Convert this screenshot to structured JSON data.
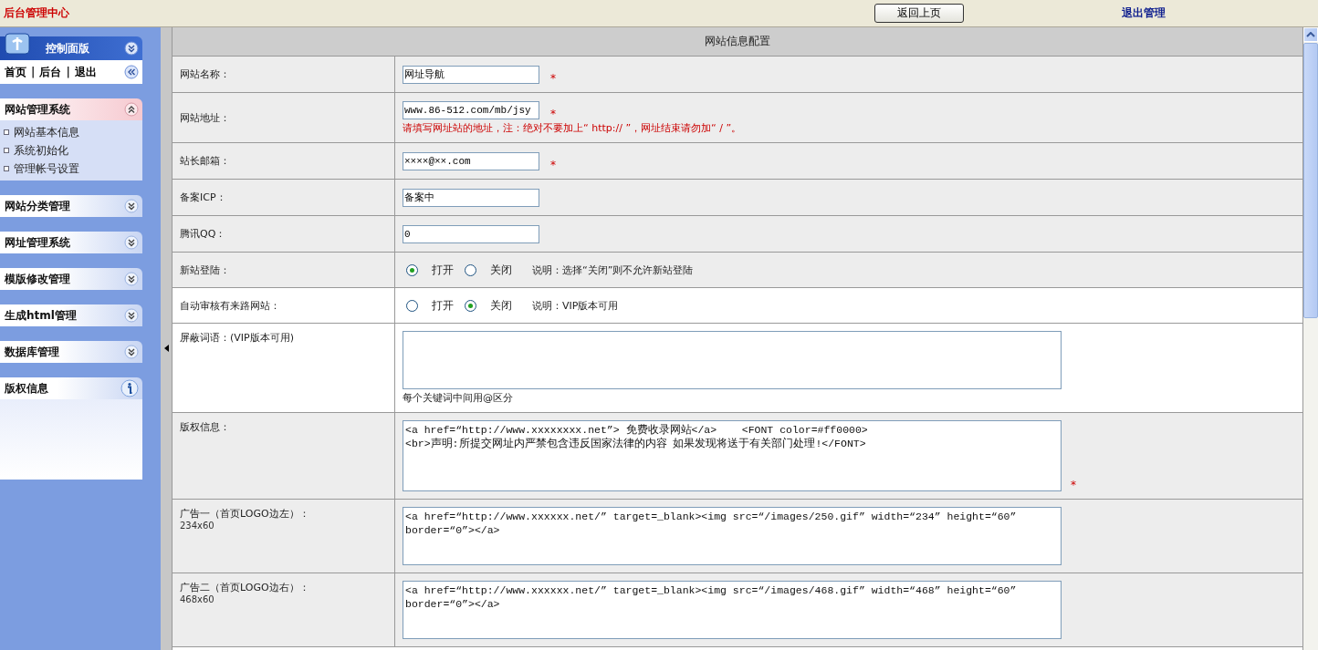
{
  "header": {
    "title": "后台管理中心",
    "back_button": "返回上页",
    "logout_link": "退出管理"
  },
  "sidebar": {
    "panel_title": "控制面版",
    "quick_links": [
      {
        "kind": "link",
        "label": "首页"
      },
      {
        "kind": "sep",
        "label": "|"
      },
      {
        "kind": "link",
        "label": "后台"
      },
      {
        "kind": "sep",
        "label": "|"
      },
      {
        "kind": "link",
        "label": "退出"
      }
    ],
    "groups": [
      {
        "kind": "menu",
        "title": "网站管理系统",
        "expanded": true,
        "items": [
          "网站基本信息",
          "系统初始化",
          "管理帐号设置"
        ]
      },
      {
        "kind": "menu",
        "title": "网站分类管理",
        "expanded": false
      },
      {
        "kind": "menu",
        "title": "网址管理系统",
        "expanded": false
      },
      {
        "kind": "menu",
        "title": "模版修改管理",
        "expanded": false
      },
      {
        "kind": "menu",
        "title": "生成html管理",
        "expanded": false
      },
      {
        "kind": "menu",
        "title": "数据库管理",
        "expanded": false
      },
      {
        "kind": "info",
        "title": "版权信息",
        "expanded": true
      }
    ]
  },
  "form": {
    "title": "网站信息配置",
    "fields": [
      {
        "kind": "text",
        "label": "网站名称：",
        "value": "网址导航",
        "required_mark": "*",
        "highlighted": false
      },
      {
        "kind": "text",
        "label": "网站地址：",
        "value": "www.86-512.com/mb/jsy",
        "required_mark": "*",
        "highlighted": false,
        "hint": "请填写网址站的地址，注：绝对不要加上“ http:// ”，网址结束请勿加“ / ”。"
      },
      {
        "kind": "text",
        "label": "站长邮箱：",
        "value": "××××@××.com",
        "required_mark": "*",
        "highlighted": false
      },
      {
        "kind": "text",
        "label": "备案ICP：",
        "value": "备案中",
        "highlighted": false
      },
      {
        "kind": "text",
        "label": "腾讯QQ：",
        "value": "0",
        "highlighted": false
      },
      {
        "kind": "radio",
        "label": "新站登陆：",
        "highlighted": false,
        "options": [
          {
            "label": "打开",
            "selected": true
          },
          {
            "label": "关闭",
            "selected": false
          }
        ],
        "note": "说明：选择“关闭”则不允许新站登陆"
      },
      {
        "kind": "radio",
        "label": "自动审核有来路网站：",
        "highlighted": true,
        "options": [
          {
            "label": "打开",
            "selected": false
          },
          {
            "label": "关闭",
            "selected": true
          }
        ],
        "note": "说明：VIP版本可用"
      },
      {
        "kind": "textarea",
        "label": "屏蔽词语：(VIP版本可用)",
        "highlighted": true,
        "hint": "每个关键词中间用@区分"
      },
      {
        "kind": "textarea",
        "label": "版权信息：",
        "highlighted": false,
        "required_mark": "*",
        "value": "<a href=“http://www.xxxxxxxx.net”> 免费收录网站</a>    <FONT color=#ff0000>\n<br>声明:所提交网址内严禁包含违反国家法律的内容 如果发现将送于有关部门处理!</FONT>"
      },
      {
        "kind": "textarea",
        "label": "广告一（首页LOGO边左）：",
        "sublabel": "234x60",
        "highlighted": false,
        "value": "<a href=“http://www.xxxxxx.net/” target=_blank><img src=“/images/250.gif” width=“234” height=“60”\nborder=“0”></a>"
      },
      {
        "kind": "textarea",
        "label": "广告二（首页LOGO边右）：",
        "sublabel": "468x60",
        "highlighted": false,
        "value": "<a href=“http://www.xxxxxx.net/” target=_blank><img src=“/images/468.gif” width=“468” height=“60”\nborder=“0”></a>"
      }
    ]
  }
}
